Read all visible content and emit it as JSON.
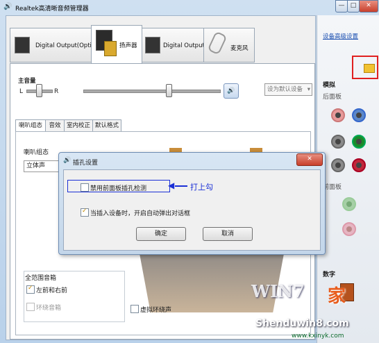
{
  "window": {
    "title": "Realtek高清晰音频管理器",
    "minimize": "—",
    "maximize": "□",
    "close": "✕"
  },
  "device_tabs": [
    {
      "label": "Digital Output(Optical)"
    },
    {
      "label": "扬声器"
    },
    {
      "label": "Digital Output"
    },
    {
      "label": "麦克风"
    }
  ],
  "volume": {
    "label": "主音量",
    "left": "L",
    "right": "R",
    "default_device": "设为默认设备"
  },
  "sub_tabs": [
    "喇叭组态",
    "音效",
    "室内校正",
    "默认格式"
  ],
  "speaker_config": {
    "label": "喇叭组态",
    "value": "立体声"
  },
  "surround": {
    "group_label": "全范围音箱",
    "front": "左前和右前",
    "surround": "环绕音箱",
    "virtual": "虚拟环绕声"
  },
  "right_panel": {
    "advanced_link": "设备高级设置",
    "analog": "模拟",
    "rear_panel": "后面板",
    "front_panel": "前面板",
    "digital": "数字"
  },
  "dialog": {
    "title": "插孔设置",
    "disable_detection": "禁用前面板插孔检测",
    "auto_popup": "当插入设备时，开启自动弹出对话框",
    "ok": "确定",
    "cancel": "取消"
  },
  "annotation": {
    "text": "打上勾",
    "color": "#1a2fd6"
  },
  "watermark": {
    "line1": "WIN7",
    "line2": "家",
    "line3": "Shenduwin8.com",
    "line4": "www.kxinyk.com"
  },
  "colors": {
    "jack_pink": "#e79a9a",
    "jack_blue": "#5b87c9",
    "jack_gray": "#8a8a8a",
    "jack_green": "#1c8a2a",
    "jack_red": "#c0283a",
    "highlight": "#e02020"
  }
}
